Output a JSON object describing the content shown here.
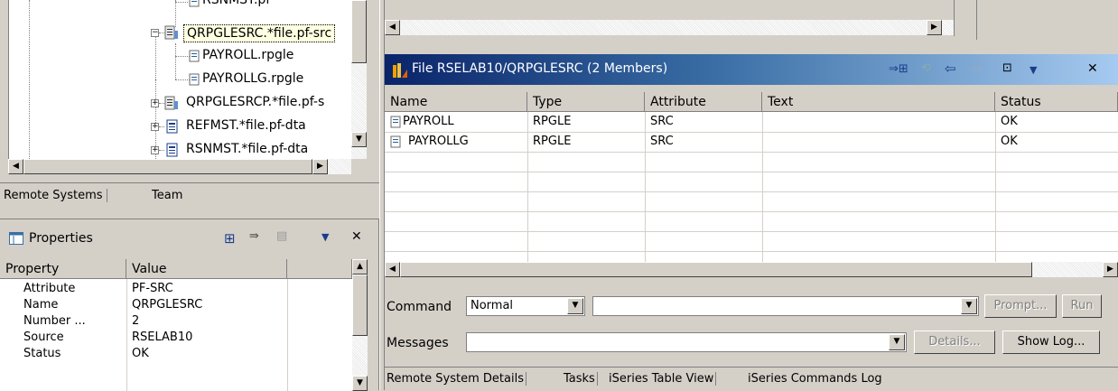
{
  "tree": {
    "items": [
      {
        "label": "RSNMST.pf",
        "kind": "member"
      },
      {
        "label": "QRPGLESRC.*file.pf-src",
        "kind": "file-selected"
      },
      {
        "label": "PAYROLL.rpgle",
        "kind": "member"
      },
      {
        "label": "PAYROLLG.rpgle",
        "kind": "member"
      },
      {
        "label": "QRPGLESRCP.*file.pf-s",
        "kind": "file"
      },
      {
        "label": "REFMST.*file.pf-dta",
        "kind": "file"
      },
      {
        "label": "RSNMST.*file.pf-dta",
        "kind": "file"
      }
    ]
  },
  "left_tabs": {
    "remote_systems": "Remote Systems",
    "team": "Team"
  },
  "properties": {
    "title": "Properties",
    "col_property": "Property",
    "col_value": "Value",
    "rows": [
      {
        "property": "Attribute",
        "value": "PF-SRC"
      },
      {
        "property": "Name",
        "value": "QRPGLESRC"
      },
      {
        "property": "Number ...",
        "value": "2"
      },
      {
        "property": "Source",
        "value": "RSELAB10"
      },
      {
        "property": "Status",
        "value": "OK"
      }
    ]
  },
  "table_view": {
    "title": "File RSELAB10/QRPGLESRC (2 Members)",
    "columns": [
      "Name",
      "Type",
      "Attribute",
      "Text",
      "Status"
    ],
    "rows": [
      {
        "name": "PAYROLL",
        "type": "RPGLE",
        "attribute": "SRC",
        "text": "",
        "status": "OK"
      },
      {
        "name": "PAYROLLG",
        "type": "RPGLE",
        "attribute": "SRC",
        "text": "",
        "status": "OK"
      }
    ]
  },
  "command": {
    "label": "Command",
    "mode": "Normal",
    "value": "",
    "prompt_label": "Prompt...",
    "run_label": "Run"
  },
  "messages": {
    "label": "Messages",
    "value": "",
    "details_label": "Details...",
    "show_log_label": "Show Log..."
  },
  "bottom_tabs": [
    "Remote System Details",
    "Tasks",
    "iSeries Table View",
    "iSeries Commands Log"
  ],
  "colors": {
    "title_gradient_start": "#0a246a",
    "title_gradient_end": "#a6caf0",
    "selection_border": "#000000"
  }
}
